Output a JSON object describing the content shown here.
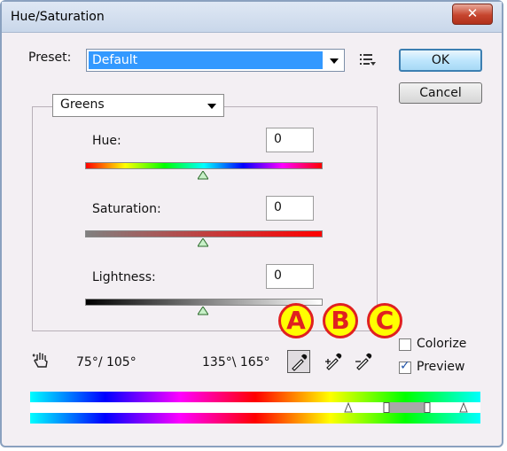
{
  "window": {
    "title": "Hue/Saturation",
    "close_glyph": "✕"
  },
  "preset": {
    "label": "Preset:",
    "value": "Default",
    "menu_icon": "preset-options-icon"
  },
  "buttons": {
    "ok": "OK",
    "cancel": "Cancel"
  },
  "channel": {
    "value": "Greens"
  },
  "hue": {
    "label": "Hue:",
    "value": "0",
    "slider_position": 0.5
  },
  "saturation": {
    "label": "Saturation:",
    "value": "0",
    "slider_position": 0.5
  },
  "lightness": {
    "label": "Lightness:",
    "value": "0",
    "slider_position": 0.5
  },
  "ranges": {
    "left": "75°/ 105°",
    "right": "135°\\ 165°"
  },
  "annotations": {
    "a": "A",
    "b": "B",
    "c": "C"
  },
  "options": {
    "colorize": "Colorize",
    "preview": "Preview",
    "colorize_checked": false,
    "preview_checked": true
  },
  "colors": {
    "accent": "#3399ff",
    "annotation_fill": "#ffff00",
    "annotation_text": "#e02020",
    "close": "#c6452e"
  }
}
